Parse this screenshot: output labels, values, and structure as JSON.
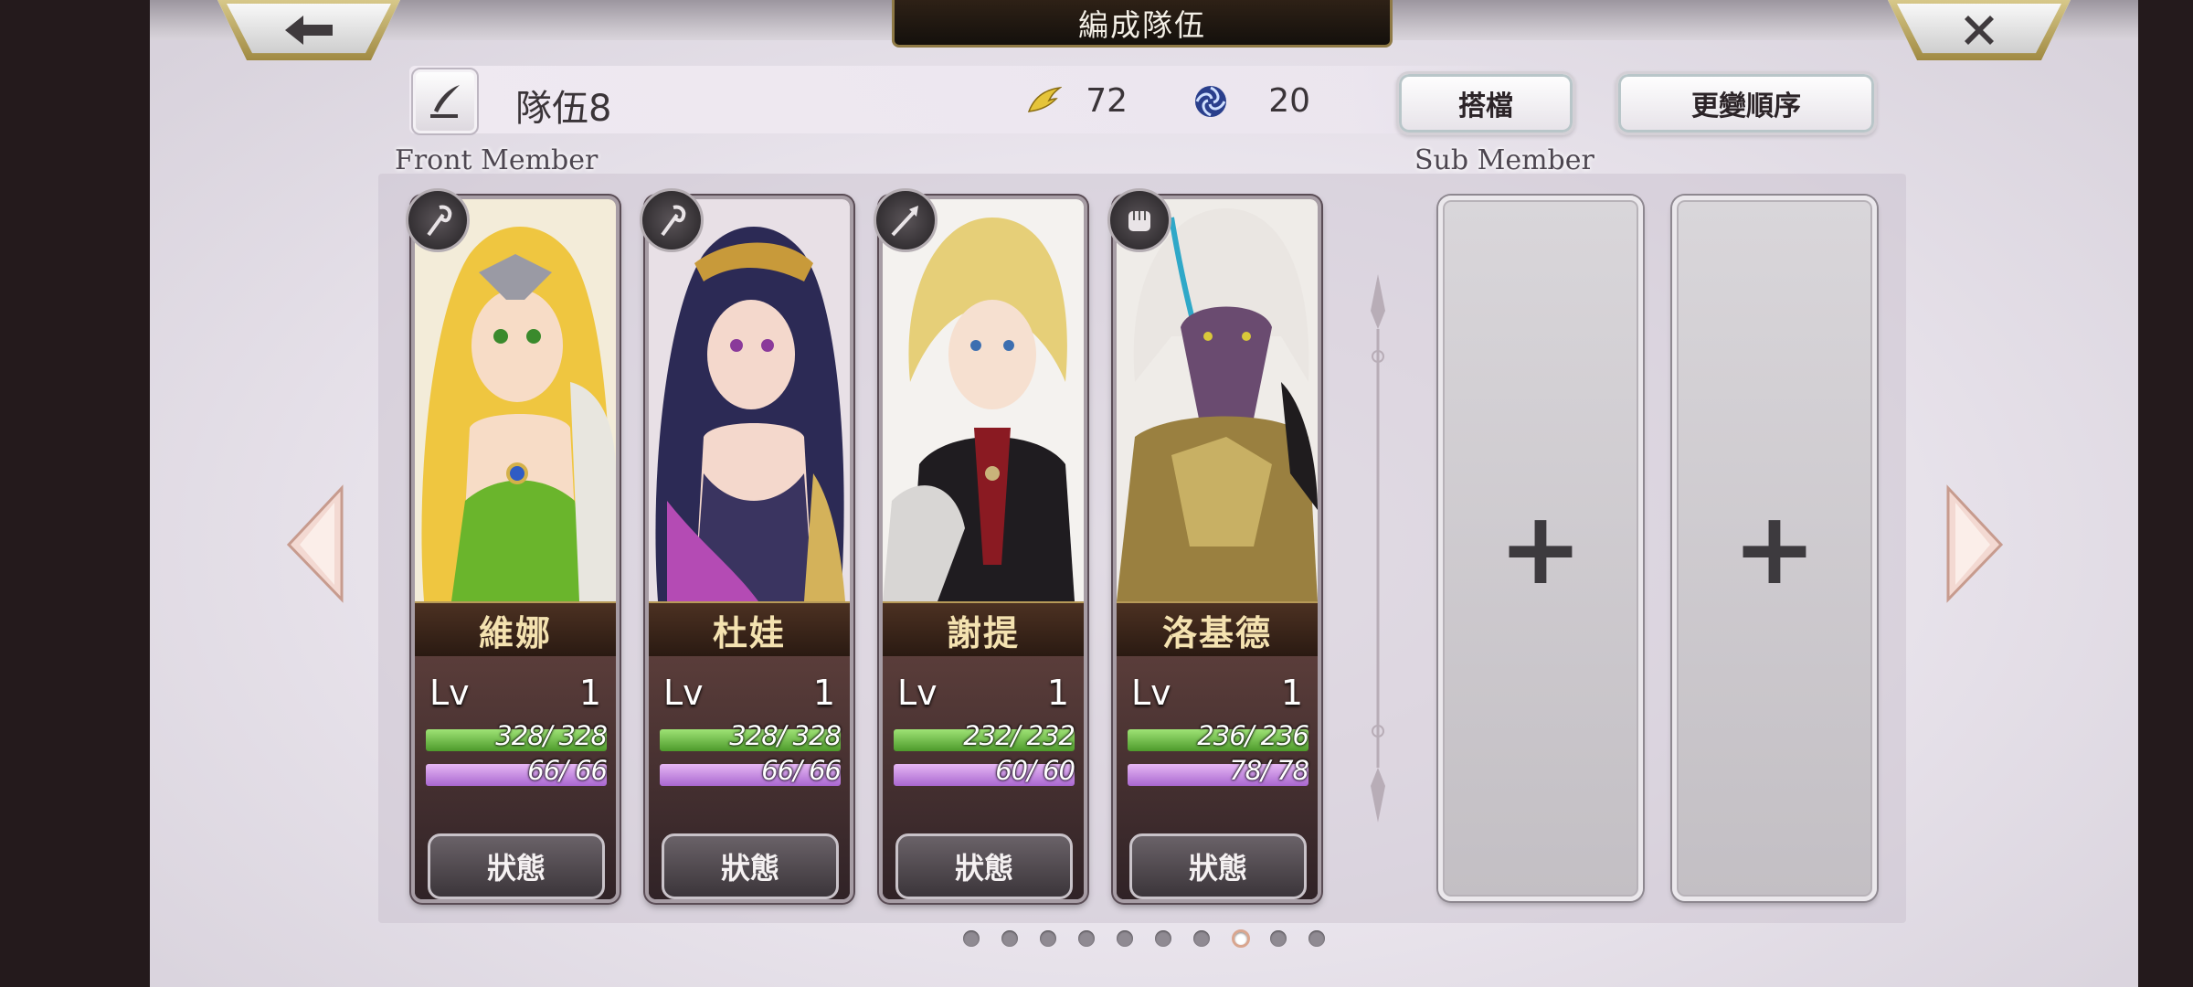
{
  "header": {
    "title": "編成隊伍",
    "back_icon": "back-arrow-icon",
    "close_icon": "close-icon"
  },
  "team": {
    "name": "隊伍8",
    "stat1_value": "72",
    "stat2_value": "20",
    "partner_button": "搭檔",
    "reorder_button": "更變順序"
  },
  "labels": {
    "front": "Front Member",
    "sub": "Sub Member"
  },
  "members": [
    {
      "name": "維娜",
      "lv_label": "Lv",
      "lv": "1",
      "hp_text": "328/ 328",
      "mp_text": "66/ 66",
      "hp_ratio": 1.0,
      "mp_ratio": 1.0,
      "status": "狀態",
      "role_icon": "staff-icon"
    },
    {
      "name": "杜娃",
      "lv_label": "Lv",
      "lv": "1",
      "hp_text": "328/ 328",
      "mp_text": "66/ 66",
      "hp_ratio": 1.0,
      "mp_ratio": 1.0,
      "status": "狀態",
      "role_icon": "staff-icon"
    },
    {
      "name": "謝提",
      "lv_label": "Lv",
      "lv": "1",
      "hp_text": "232/ 232",
      "mp_text": "60/ 60",
      "hp_ratio": 1.0,
      "mp_ratio": 1.0,
      "status": "狀態",
      "role_icon": "spear-icon"
    },
    {
      "name": "洛基德",
      "lv_label": "Lv",
      "lv": "1",
      "hp_text": "236/ 236",
      "mp_text": "78/ 78",
      "hp_ratio": 1.0,
      "mp_ratio": 1.0,
      "status": "狀態",
      "role_icon": "fist-icon"
    }
  ],
  "sub_slots": [
    {
      "icon": "plus-icon",
      "label": "+"
    },
    {
      "icon": "plus-icon",
      "label": "+"
    }
  ],
  "pagination": {
    "total": 10,
    "current": 8
  },
  "colors": {
    "hp": "#6fbf45",
    "mp": "#c98ae6",
    "name_text": "#f4e2b0",
    "title_plate": "#1e1711"
  }
}
